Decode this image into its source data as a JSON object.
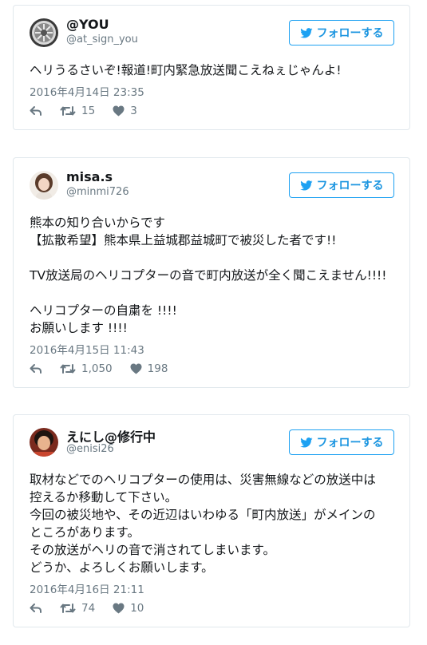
{
  "colors": {
    "accent": "#1da1f2",
    "follow_text": "#1b95e0",
    "meta_text": "#697882",
    "border": "#e1e8ed",
    "body_text": "#14171a"
  },
  "tweets": [
    {
      "name": "@YOU",
      "handle": "@at_sign_you",
      "avatar_icon": "car-wheel-avatar",
      "follow_label": "フォローする",
      "text_lines": [
        "ヘリうるさいぞ!報道!町内緊急放送聞こえねぇじゃんよ!"
      ],
      "timestamp": "2016年4月14日 23:35",
      "retweets": "15",
      "likes": "3"
    },
    {
      "name": "misa.s",
      "handle": "@minmi726",
      "avatar_icon": "person-photo-avatar",
      "follow_label": "フォローする",
      "text_lines": [
        "熊本の知り合いからです",
        "【拡散希望】熊本県上益城郡益城町で被災した者です!!",
        "",
        "TV放送局のヘリコプターの音で町内放送が全く聞こえません!!!!",
        "",
        "ヘリコプターの自粛を !!!!",
        "お願いします !!!!"
      ],
      "timestamp": "2016年4月15日 11:43",
      "retweets": "1,050",
      "likes": "198"
    },
    {
      "name": "えにし@修行中",
      "handle": "@enisi26",
      "avatar_icon": "person-photo-avatar",
      "follow_label": "フォローする",
      "text_lines": [
        "取材などでのヘリコプターの使用は、災害無線などの放送中は",
        "控えるか移動して下さい。",
        "今回の被災地や、その近辺はいわゆる「町内放送」がメインの",
        "ところがあります。",
        "その放送がヘリの音で消されてしまいます。",
        "どうか、よろしくお願いします。"
      ],
      "timestamp": "2016年4月16日 21:11",
      "retweets": "74",
      "likes": "10"
    }
  ]
}
